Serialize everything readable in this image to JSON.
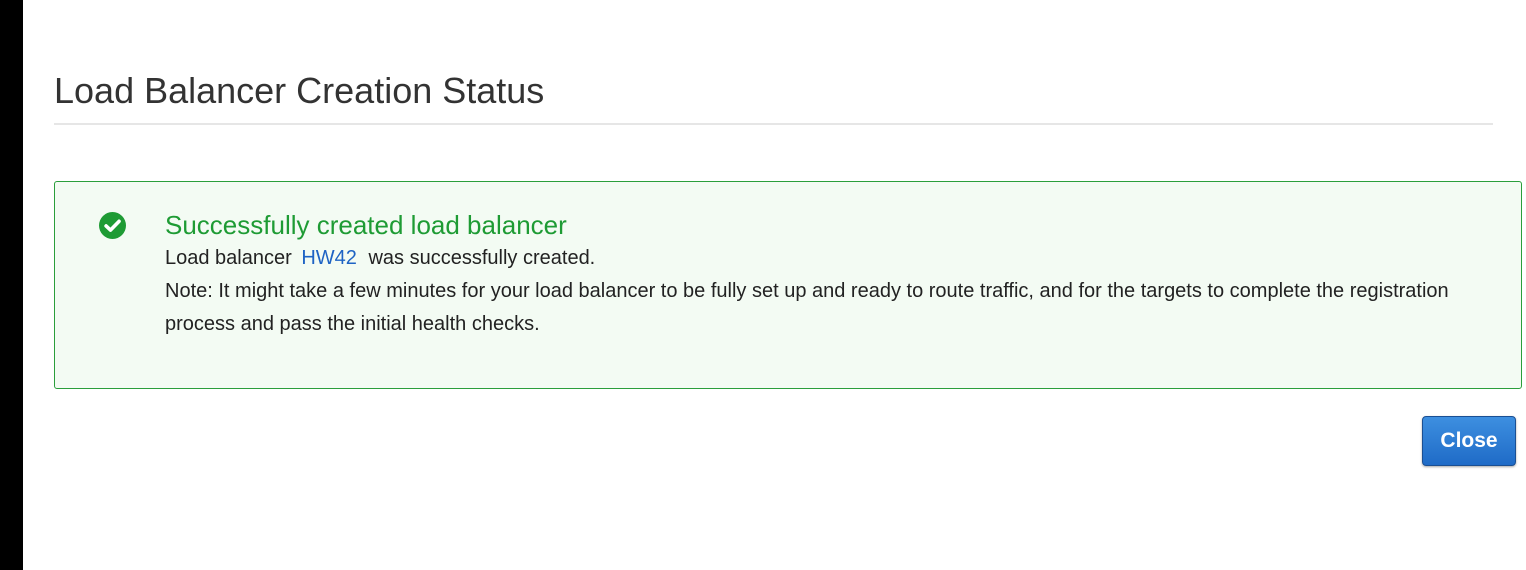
{
  "dialog": {
    "title": "Load Balancer Creation Status",
    "close_label": "Close"
  },
  "alert": {
    "status": "success",
    "icon": "check-circle-icon",
    "heading": "Successfully created load balancer",
    "message_prefix": "Load balancer",
    "load_balancer_name": "HW42",
    "message_suffix": "was successfully created.",
    "note": "Note: It might take a few minutes for your load balancer to be fully set up and ready to route traffic, and for the targets to complete the registration process and pass the initial health checks."
  },
  "colors": {
    "success_green": "#1e9b34",
    "success_border": "#2a9e3b",
    "success_background": "#f3fbf3",
    "link_blue": "#1e63c4",
    "primary_button": "#1f6bc7"
  }
}
